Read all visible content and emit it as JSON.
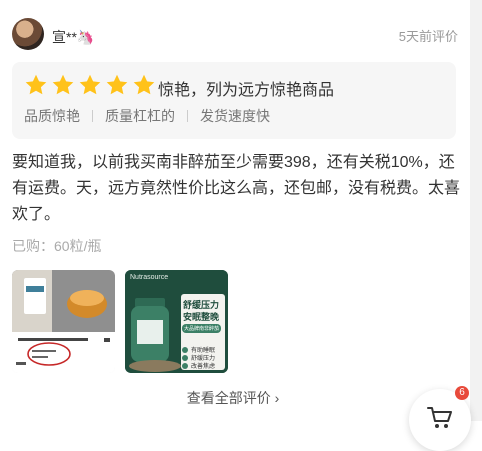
{
  "review": {
    "user_name": "宣**🦄",
    "time": "5天前评价",
    "rating_text": "惊艳，列为远方惊艳商品",
    "stars": 5,
    "tags": [
      "品质惊艳",
      "质量杠杠的",
      "发货速度快"
    ],
    "body": "要知道我，以前我买南非醉茄至少需要398，还有关税10%，还有运费。天，远方竟然性价比这么高，还包邮，没有税费。太喜欢了。",
    "purchase_info": "已购：60粒/瓶"
  },
  "photos": {
    "photo2": {
      "brand": "Nutrasource",
      "headline_1": "舒缓压力",
      "headline_2": "安眠整晚",
      "pill": "大品牌南非醉茄",
      "features": [
        "有助睡眠",
        "舒缓压力",
        "改善焦虑"
      ]
    }
  },
  "footer": {
    "view_all": "查看全部评价 ›",
    "cart_count": "6"
  },
  "colors": {
    "star": "#ffc21a",
    "badge": "#e84a3b",
    "box_bg": "#f6f6f6"
  }
}
